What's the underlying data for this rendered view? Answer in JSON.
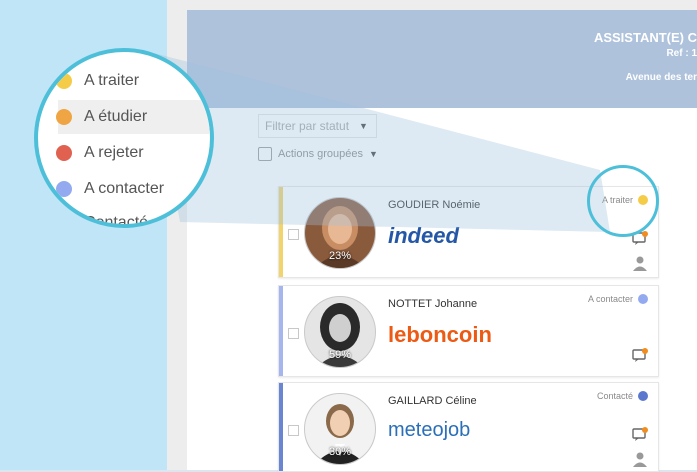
{
  "header": {
    "title": "ASSISTANT(E) C",
    "ref": "Ref : 1",
    "address": "Avenue des ter"
  },
  "filter": {
    "label": "Filtrer par statut"
  },
  "actions": {
    "label": "Actions groupées"
  },
  "magnifier": {
    "items": [
      {
        "label": "A traiter",
        "color": "#f5cc47"
      },
      {
        "label": "A étudier",
        "color": "#f0a544"
      },
      {
        "label": "A rejeter",
        "color": "#e06150"
      },
      {
        "label": "A contacter",
        "color": "#93aaf0"
      },
      {
        "label": "Contacté",
        "color": "#6a86d3"
      }
    ]
  },
  "candidates": [
    {
      "name": "GOUDIER Noémie",
      "match": "23%",
      "source": "indeed",
      "status": "A traiter",
      "status_color": "#f5cc47",
      "bar_color": "#f2d46a"
    },
    {
      "name": "NOTTET Johanne",
      "match": "59%",
      "source": "leboncoin",
      "status": "A contacter",
      "status_color": "#93aaf0",
      "bar_color": "#a5b6ef"
    },
    {
      "name": "GAILLARD Céline",
      "match": "30%",
      "source": "meteojob",
      "status": "Contacté",
      "status_color": "#5b78cc",
      "bar_color": "#6a86d3"
    }
  ],
  "colors": {
    "indeed": "#2557a7",
    "leboncoin": "#ec5a13",
    "meteojob": "#2b6fb8",
    "accent": "#4dbfd9"
  }
}
